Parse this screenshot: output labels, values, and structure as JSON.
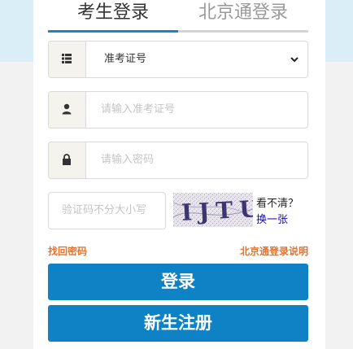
{
  "tabs": {
    "student_login": "考生登录",
    "beijingtong_login": "北京通登录"
  },
  "form": {
    "id_type_selected": "准考证号",
    "exam_id_placeholder": "请输入准考证号",
    "password_placeholder": "请输入密码",
    "captcha_placeholder": "验证码不分大小写",
    "captcha_text": "IJTU",
    "captcha_hint": "看不清？",
    "captcha_refresh": "换一张"
  },
  "links": {
    "forgot_password": "找回密码",
    "beijingtong_help": "北京通登录说明"
  },
  "buttons": {
    "login": "登录",
    "register": "新生注册"
  },
  "colors": {
    "accent": "#0e82c5",
    "link_orange": "#e3742e",
    "link_blue": "#1a0dab"
  },
  "icons": {
    "select": "list-icon",
    "user": "user-icon",
    "password": "lock-icon"
  }
}
